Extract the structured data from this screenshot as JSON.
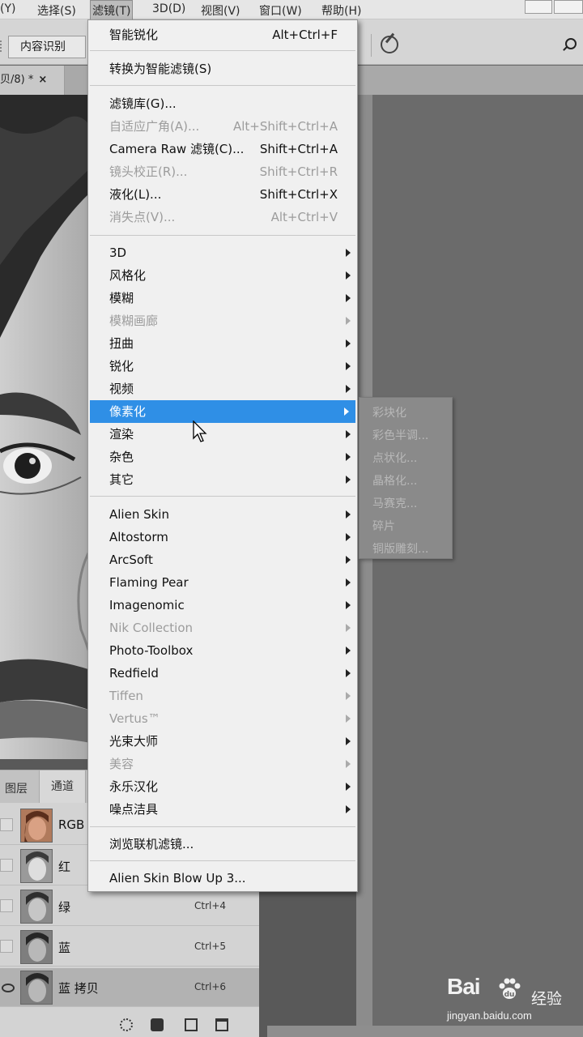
{
  "menubar": {
    "items": [
      {
        "label": "(Y)"
      },
      {
        "label": "选择(S)"
      },
      {
        "label": "滤镜(T)"
      },
      {
        "label": "3D(D)"
      },
      {
        "label": "视图(V)"
      },
      {
        "label": "窗口(W)"
      },
      {
        "label": "帮助(H)"
      }
    ]
  },
  "options": {
    "content_aware": "内容识别"
  },
  "document": {
    "tab_title": "贝/8) *",
    "close_glyph": "×"
  },
  "filter_menu": {
    "items": [
      {
        "label": "智能锐化",
        "shortcut": "Alt+Ctrl+F"
      },
      {
        "label": "转换为智能滤镜(S)"
      },
      {
        "label": "滤镜库(G)..."
      },
      {
        "label": "自适应广角(A)...",
        "shortcut": "Alt+Shift+Ctrl+A"
      },
      {
        "label": "Camera Raw 滤镜(C)...",
        "shortcut": "Shift+Ctrl+A"
      },
      {
        "label": "镜头校正(R)...",
        "shortcut": "Shift+Ctrl+R"
      },
      {
        "label": "液化(L)...",
        "shortcut": "Shift+Ctrl+X"
      },
      {
        "label": "消失点(V)...",
        "shortcut": "Alt+Ctrl+V"
      },
      {
        "label": "3D"
      },
      {
        "label": "风格化"
      },
      {
        "label": "模糊"
      },
      {
        "label": "模糊画廊"
      },
      {
        "label": "扭曲"
      },
      {
        "label": "锐化"
      },
      {
        "label": "视频"
      },
      {
        "label": "像素化"
      },
      {
        "label": "渲染"
      },
      {
        "label": "杂色"
      },
      {
        "label": "其它"
      },
      {
        "label": "Alien Skin"
      },
      {
        "label": "Altostorm"
      },
      {
        "label": "ArcSoft"
      },
      {
        "label": "Flaming Pear"
      },
      {
        "label": "Imagenomic"
      },
      {
        "label": "Nik Collection"
      },
      {
        "label": "Photo-Toolbox"
      },
      {
        "label": "Redfield"
      },
      {
        "label": "Tiffen"
      },
      {
        "label": "Vertus™"
      },
      {
        "label": "光束大师"
      },
      {
        "label": "美容"
      },
      {
        "label": "永乐汉化"
      },
      {
        "label": "噪点洁具"
      },
      {
        "label": "浏览联机滤镜..."
      },
      {
        "label": "Alien Skin Blow Up 3..."
      }
    ]
  },
  "pixelate_submenu": {
    "items": [
      {
        "label": "彩块化"
      },
      {
        "label": "彩色半调..."
      },
      {
        "label": "点状化..."
      },
      {
        "label": "晶格化..."
      },
      {
        "label": "马赛克..."
      },
      {
        "label": "碎片"
      },
      {
        "label": "铜版雕刻..."
      }
    ]
  },
  "panel": {
    "tabs": [
      {
        "label": "图层"
      },
      {
        "label": "通道"
      }
    ],
    "channels": [
      {
        "name": "RGB",
        "shortcut": ""
      },
      {
        "name": "红",
        "shortcut": ""
      },
      {
        "name": "绿",
        "shortcut": "Ctrl+4"
      },
      {
        "name": "蓝",
        "shortcut": "Ctrl+5"
      },
      {
        "name": "蓝 拷贝",
        "shortcut": "Ctrl+6"
      }
    ]
  },
  "watermark": {
    "brand": "Bai",
    "suffix": "经验",
    "url": "jingyan.baidu.com"
  },
  "colors": {
    "highlight": "#2f8fe6",
    "menu_bg": "#f0f0f0",
    "disabled_text": "#9c9c9c"
  },
  "icons": [
    "search-icon",
    "brush-icon",
    "cursor-arrow-icon",
    "eye-icon",
    "chevron-right-icon",
    "baidu-paw-icon"
  ]
}
